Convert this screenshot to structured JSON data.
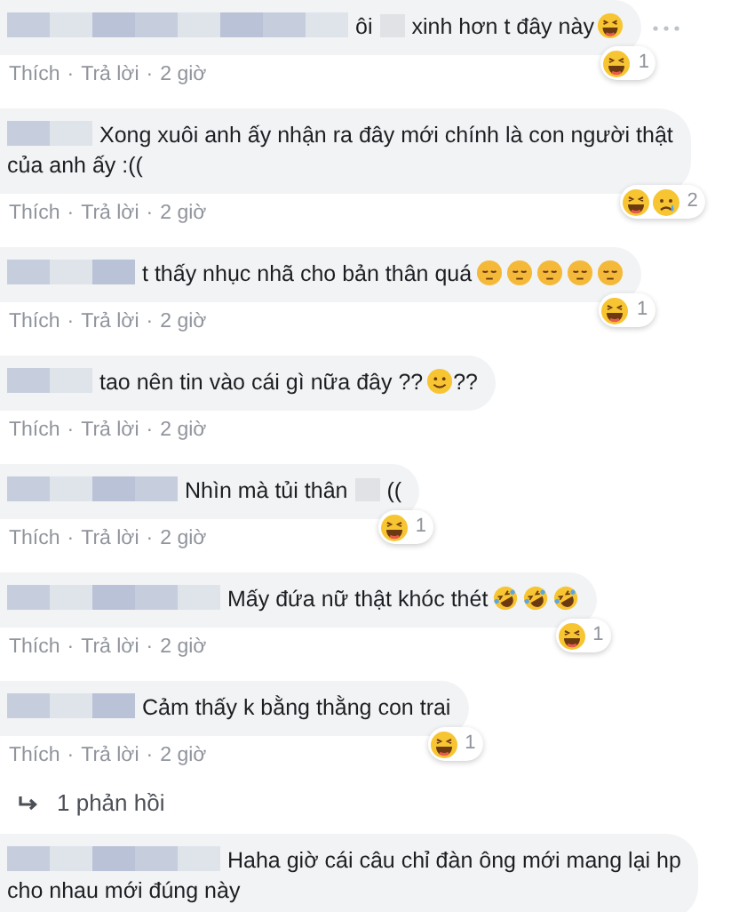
{
  "comments": [
    {
      "menu_visible": true,
      "message": [
        {
          "kind": "tile"
        },
        {
          "kind": "tile"
        },
        {
          "kind": "tile"
        },
        {
          "kind": "tile"
        },
        {
          "kind": "tile"
        },
        {
          "kind": "tile"
        },
        {
          "kind": "tile"
        },
        {
          "kind": "tile"
        },
        {
          "kind": "text",
          "text": "ôi"
        },
        {
          "kind": "blur"
        },
        {
          "kind": "text",
          "text": "xinh hơn t đây này"
        },
        {
          "kind": "laugh"
        }
      ],
      "reactions": {
        "icons": [
          {
            "kind": "laugh"
          }
        ],
        "count": "1"
      },
      "actions": [
        "Thích",
        "·",
        "Trả lời",
        "·",
        "2 giờ"
      ]
    },
    {
      "menu_visible": false,
      "message": [
        {
          "kind": "tile"
        },
        {
          "kind": "tile"
        },
        {
          "kind": "text",
          "text": "Xong xuôi anh ấy nhận ra đây mới chính là con người thật"
        },
        {
          "kind": "break"
        },
        {
          "kind": "text",
          "text": "của anh ấy :(("
        }
      ],
      "reactions": {
        "icons": [
          {
            "kind": "laugh"
          },
          {
            "kind": "sad"
          }
        ],
        "count": "2"
      },
      "actions": [
        "Thích",
        "·",
        "Trả lời",
        "·",
        "2 giờ"
      ]
    },
    {
      "menu_visible": false,
      "message": [
        {
          "kind": "tile"
        },
        {
          "kind": "tile"
        },
        {
          "kind": "tile"
        },
        {
          "kind": "text",
          "text": "t thấy nhục nhã cho bản thân quá"
        },
        {
          "kind": "pensive"
        },
        {
          "kind": "pensive"
        },
        {
          "kind": "pensive"
        },
        {
          "kind": "pensive"
        },
        {
          "kind": "pensive"
        }
      ],
      "reactions": {
        "icons": [
          {
            "kind": "laugh"
          }
        ],
        "count": "1"
      },
      "actions": [
        "Thích",
        "·",
        "Trả lời",
        "·",
        "2 giờ"
      ]
    },
    {
      "menu_visible": false,
      "message": [
        {
          "kind": "tile"
        },
        {
          "kind": "tile"
        },
        {
          "kind": "text",
          "text": "tao nên tin vào cái gì nữa đây ??"
        },
        {
          "kind": "smile"
        },
        {
          "kind": "text",
          "text": "??"
        }
      ],
      "actions": [
        "Thích",
        "·",
        "Trả lời",
        "·",
        "2 giờ"
      ]
    },
    {
      "menu_visible": false,
      "message": [
        {
          "kind": "tile"
        },
        {
          "kind": "tile"
        },
        {
          "kind": "tile"
        },
        {
          "kind": "tile"
        },
        {
          "kind": "text",
          "text": "Nhìn mà tủi thân"
        },
        {
          "kind": "blur"
        },
        {
          "kind": "text",
          "text": "(("
        }
      ],
      "reactions": {
        "icons": [
          {
            "kind": "laugh"
          }
        ],
        "count": "1"
      },
      "actions": [
        "Thích",
        "·",
        "Trả lời",
        "·",
        "2 giờ"
      ]
    },
    {
      "menu_visible": false,
      "message": [
        {
          "kind": "tile"
        },
        {
          "kind": "tile"
        },
        {
          "kind": "tile"
        },
        {
          "kind": "tile"
        },
        {
          "kind": "tile"
        },
        {
          "kind": "text",
          "text": "Mấy đứa nữ thật khóc thét"
        },
        {
          "kind": "rofl"
        },
        {
          "kind": "rofl"
        },
        {
          "kind": "rofl"
        }
      ],
      "reactions": {
        "icons": [
          {
            "kind": "laugh"
          }
        ],
        "count": "1"
      },
      "actions": [
        "Thích",
        "·",
        "Trả lời",
        "·",
        "2 giờ"
      ]
    },
    {
      "menu_visible": false,
      "message": [
        {
          "kind": "tile"
        },
        {
          "kind": "tile"
        },
        {
          "kind": "tile"
        },
        {
          "kind": "text",
          "text": "Cảm thấy k bằng thằng con trai"
        }
      ],
      "reactions": {
        "icons": [
          {
            "kind": "laugh"
          }
        ],
        "count": "1"
      },
      "actions": [
        "Thích",
        "·",
        "Trả lời",
        "·",
        "2 giờ"
      ],
      "replies_link": "1 phản hồi"
    },
    {
      "menu_visible": false,
      "message": [
        {
          "kind": "tile"
        },
        {
          "kind": "tile"
        },
        {
          "kind": "tile"
        },
        {
          "kind": "tile"
        },
        {
          "kind": "tile"
        },
        {
          "kind": "text",
          "text": "Haha giờ cái câu chỉ đàn ông mới mang lại hp"
        },
        {
          "kind": "break"
        },
        {
          "kind": "text",
          "text": "cho nhau mới đúng này"
        }
      ]
    }
  ]
}
